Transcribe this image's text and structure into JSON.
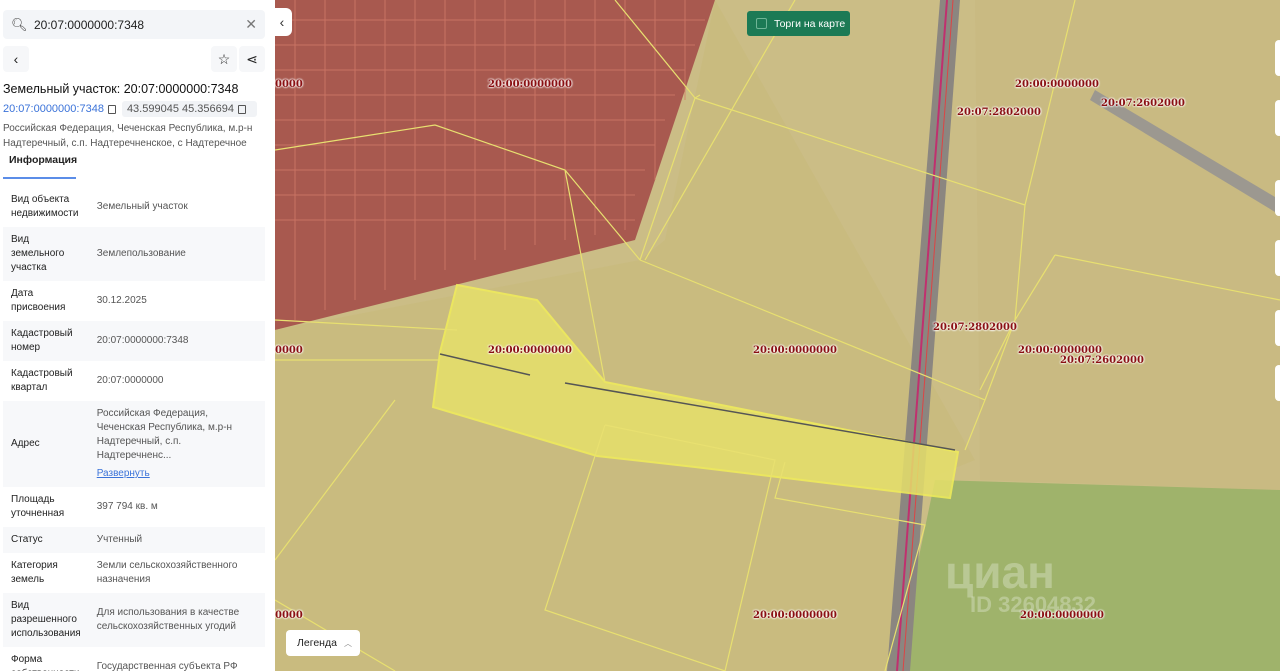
{
  "search": {
    "value": "20:07:0000000:7348"
  },
  "header": {
    "title": "Земельный участок: 20:07:0000000:7348",
    "cadastral_link": "20:07:0000000:7348",
    "coords": "43.599045 45.356694",
    "address": "Российская Федерация, Чеченская Республика, м.р-н Надтеречный, с.п. Надтеречненское, с Надтеречное"
  },
  "tabs": [
    {
      "label": "Информация"
    }
  ],
  "info": [
    {
      "key": "Вид объекта недвижимости",
      "value": "Земельный участок"
    },
    {
      "key": "Вид земельного участка",
      "value": "Землепользование"
    },
    {
      "key": "Дата присвоения",
      "value": "30.12.2025"
    },
    {
      "key": "Кадастровый номер",
      "value": "20:07:0000000:7348"
    },
    {
      "key": "Кадастровый квартал",
      "value": "20:07:0000000"
    },
    {
      "key": "Адрес",
      "value": "Российская Федерация, Чеченская Республика, м.р-н Надтеречный, с.п. Надтеречненс...",
      "link": "Развернуть"
    },
    {
      "key": "Площадь уточненная",
      "value": "397 794 кв. м"
    },
    {
      "key": "Статус",
      "value": "Учтенный"
    },
    {
      "key": "Категория земель",
      "value": "Земли сельскохозяйственного назначения"
    },
    {
      "key": "Вид разрешенного использования",
      "value": "Для использования в качестве сельскохозяйственных угодий"
    },
    {
      "key": "Форма собственности",
      "value": "Государственная субъекта РФ"
    }
  ],
  "map": {
    "torgi_label": "Торги на карте",
    "legend_label": "Легенда",
    "labels": [
      "20:00:0000000",
      "20:00:0000000",
      "20:07:2802000",
      "20:07:2602000",
      "20:00:0000000",
      "20:00:0000000",
      "20:07:2802000",
      "20:00:0000000",
      "20:07:2602000",
      "20:00:0000000",
      "20:00:0000000",
      "0000",
      "0000",
      "0000"
    ],
    "watermark": "циан",
    "watermark_id": "ID 32604832",
    "highlight_color": "#e6e06a",
    "boundary_color": "#f2ee5a"
  }
}
